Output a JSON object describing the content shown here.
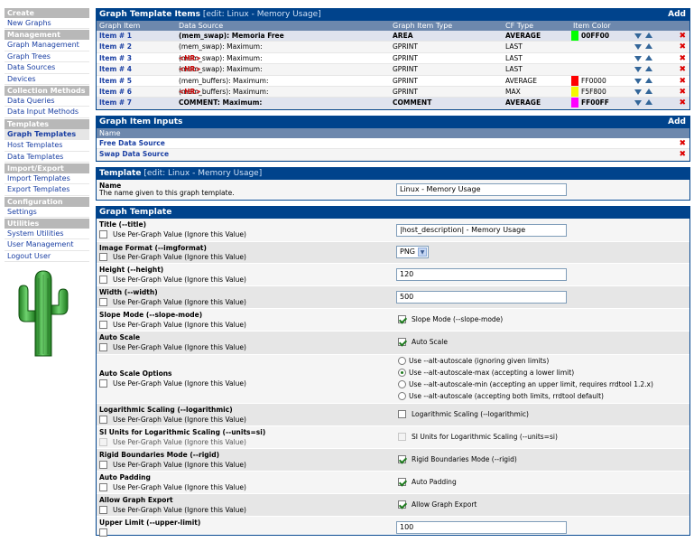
{
  "sidebar": {
    "sections": [
      {
        "title": "Create",
        "items": [
          "New Graphs"
        ]
      },
      {
        "title": "Management",
        "items": [
          "Graph Management",
          "Graph Trees",
          "Data Sources",
          "Devices"
        ]
      },
      {
        "title": "Collection Methods",
        "items": [
          "Data Queries",
          "Data Input Methods"
        ]
      },
      {
        "title": "Templates",
        "items": [
          "Graph Templates",
          "Host Templates",
          "Data Templates"
        ]
      },
      {
        "title": "Import/Export",
        "items": [
          "Import Templates",
          "Export Templates"
        ]
      },
      {
        "title": "Configuration",
        "items": [
          "Settings"
        ]
      },
      {
        "title": "Utilities",
        "items": [
          "System Utilities",
          "User Management",
          "Logout User"
        ]
      }
    ],
    "active": "Graph Templates"
  },
  "items_box": {
    "title": "Graph Template Items",
    "edit": "[edit: Linux - Memory Usage]",
    "add": "Add",
    "columns": [
      "Graph Item",
      "Data Source",
      "Graph Item Type",
      "CF Type",
      "Item Color"
    ],
    "rows": [
      {
        "item": "Item # 1",
        "source": "(mem_swap): Memoria Free",
        "hr": "",
        "type": "AREA",
        "cf": "AVERAGE",
        "color": "00FF00",
        "selected": true
      },
      {
        "item": "Item # 2",
        "source": "(mem_swap): Maximum:",
        "hr": "",
        "type": "GPRINT",
        "cf": "LAST",
        "color": "",
        "selected": false
      },
      {
        "item": "Item # 3",
        "source": "(mem_swap): Maximum:",
        "hr": "<HR>",
        "type": "GPRINT",
        "cf": "LAST",
        "color": "",
        "selected": false
      },
      {
        "item": "Item # 4",
        "source": "(mem_swap): Maximum:",
        "hr": "<HR>",
        "type": "GPRINT",
        "cf": "LAST",
        "color": "",
        "selected": false
      },
      {
        "item": "Item # 5",
        "source": "(mem_buffers): Maximum:",
        "hr": "",
        "type": "GPRINT",
        "cf": "AVERAGE",
        "color": "FF0000",
        "selected": false
      },
      {
        "item": "Item # 6",
        "source": "(mem_buffers): Maximum:",
        "hr": "<HR>",
        "type": "GPRINT",
        "cf": "MAX",
        "color": "F5F800",
        "selected": false
      },
      {
        "item": "Item # 7",
        "source": "COMMENT: Maximum:",
        "hr": "",
        "type": "COMMENT",
        "cf": "AVERAGE",
        "color": "FF00FF",
        "selected": true
      }
    ]
  },
  "inputs_box": {
    "title": "Graph Item Inputs",
    "add": "Add",
    "column": "Name",
    "rows": [
      "Free Data Source",
      "Swap Data Source"
    ]
  },
  "template_box": {
    "title": "Template",
    "edit": "[edit: Linux - Memory Usage]",
    "name_label": "Name",
    "name_desc": "The name given to this graph template.",
    "name_value": "Linux - Memory Usage"
  },
  "graph_template": {
    "title": "Graph Template",
    "per_graph": "Use Per-Graph Value (Ignore this Value)",
    "fields": {
      "title": {
        "label": "Title (--title)",
        "value": "|host_description| - Memory Usage"
      },
      "imgformat": {
        "label": "Image Format (--imgformat)",
        "value": "PNG"
      },
      "height": {
        "label": "Height (--height)",
        "value": "120"
      },
      "width": {
        "label": "Width (--width)",
        "value": "500"
      },
      "slope": {
        "label": "Slope Mode (--slope-mode)",
        "check": "Slope Mode (--slope-mode)"
      },
      "autoscale": {
        "label": "Auto Scale",
        "check": "Auto Scale"
      },
      "autoscale_opts": {
        "label": "Auto Scale Options",
        "options": [
          "Use --alt-autoscale (ignoring given limits)",
          "Use --alt-autoscale-max (accepting a lower limit)",
          "Use --alt-autoscale-min (accepting an upper limit, requires rrdtool 1.2.x)",
          "Use --alt-autoscale (accepting both limits, rrdtool default)"
        ],
        "selected": 1
      },
      "log": {
        "label": "Logarithmic Scaling (--logarithmic)",
        "check": "Logarithmic Scaling (--logarithmic)"
      },
      "si": {
        "label": "SI Units for Logarithmic Scaling (--units=si)",
        "check": "SI Units for Logarithmic Scaling (--units=si)"
      },
      "rigid": {
        "label": "Rigid Boundaries Mode (--rigid)",
        "check": "Rigid Boundaries Mode (--rigid)"
      },
      "padding": {
        "label": "Auto Padding",
        "check": "Auto Padding"
      },
      "export": {
        "label": "Allow Graph Export",
        "check": "Allow Graph Export"
      },
      "upper": {
        "label": "Upper Limit (--upper-limit)",
        "value": "100"
      }
    }
  }
}
